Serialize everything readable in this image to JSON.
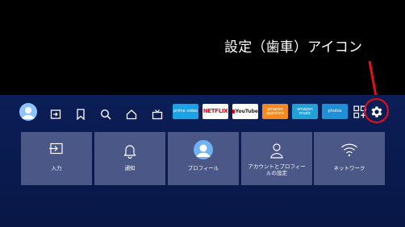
{
  "annotation": {
    "text": "設定（歯車）アイコン"
  },
  "apps": [
    {
      "name": "prime-video",
      "label": "prime video"
    },
    {
      "name": "netflix",
      "label": "NETFLIX"
    },
    {
      "name": "youtube",
      "label": "YouTube"
    },
    {
      "name": "appstore",
      "label": "amazon appstore"
    },
    {
      "name": "amazon-music",
      "label": "amazon music"
    },
    {
      "name": "photos",
      "label": "photos"
    }
  ],
  "nav_icons": [
    "profile-icon",
    "input-icon",
    "bookmark-icon",
    "search-icon",
    "home-icon",
    "live-tv-icon",
    "app-grid-icon",
    "gear-icon"
  ],
  "cards": [
    {
      "label": "入力",
      "icon": "input-icon"
    },
    {
      "label": "通知",
      "icon": "bell-icon"
    },
    {
      "label": "プロフィール",
      "icon": "avatar-icon"
    },
    {
      "label": "アカウントとプロフィールの設定",
      "line1": "アカウントとプロフィー",
      "line2": "ルの設定",
      "icon": "person-icon"
    },
    {
      "label": "ネットワーク",
      "icon": "wifi-icon"
    }
  ],
  "colors": {
    "highlight": "#e3101a",
    "background": "#0a1a4e",
    "card": "#4a5787"
  }
}
